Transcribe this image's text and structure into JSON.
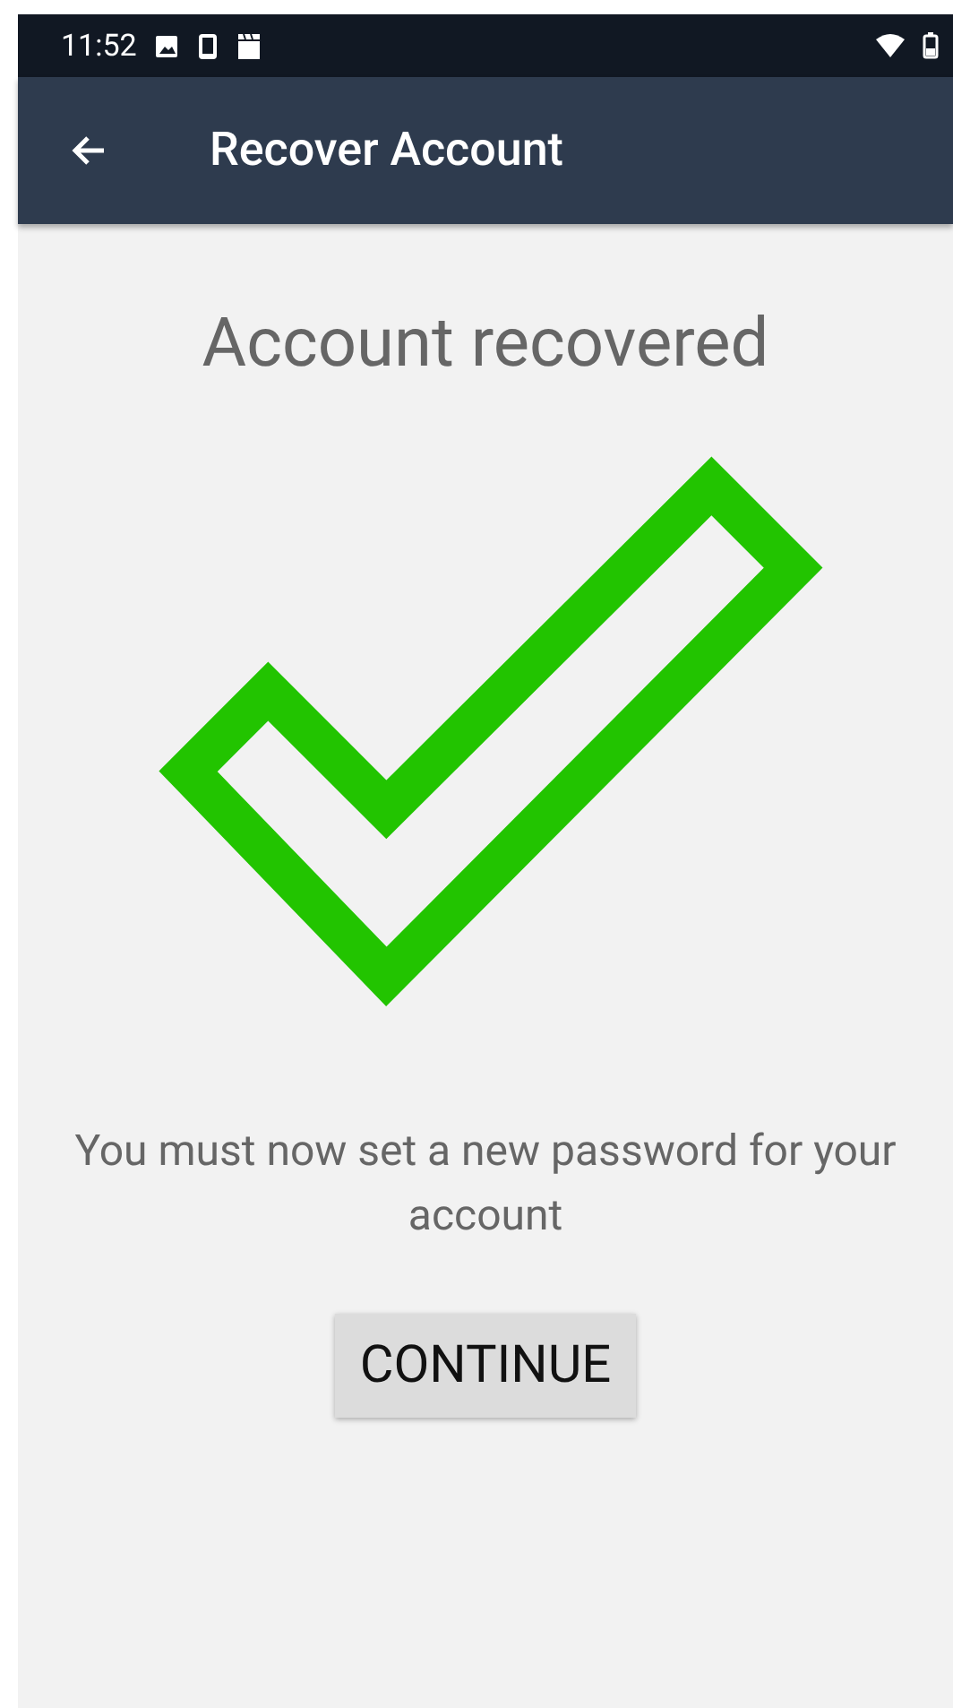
{
  "status_bar": {
    "time": "11:52"
  },
  "app_bar": {
    "title": "Recover Account"
  },
  "heading": "Account recovered",
  "message": "You must now set a new password for your account",
  "button": "CONTINUE"
}
